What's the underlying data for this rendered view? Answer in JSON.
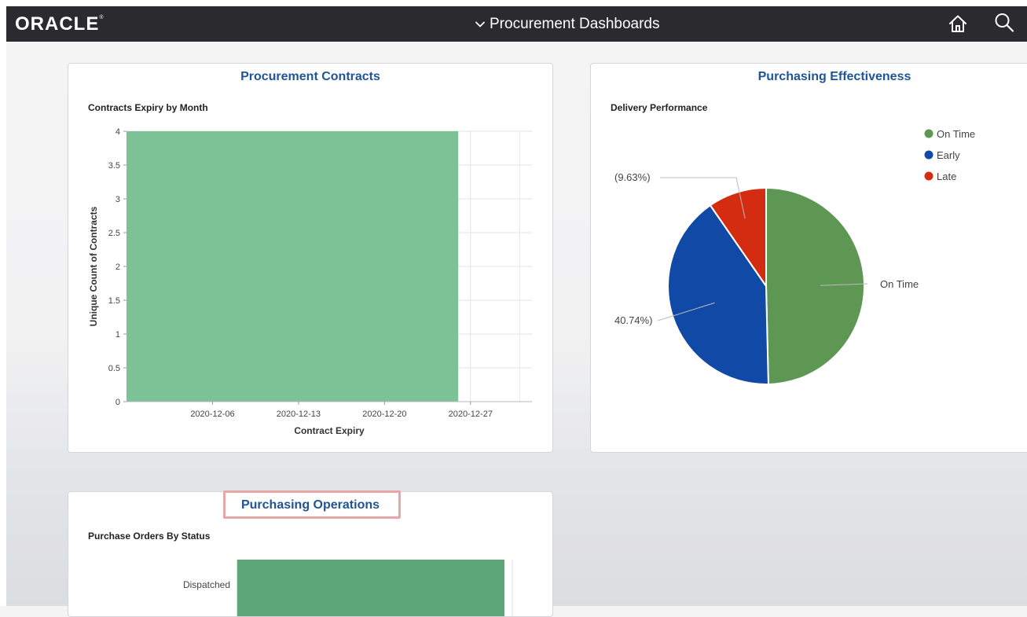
{
  "header": {
    "logo": "ORACLE",
    "title": "Procurement Dashboards",
    "icons": [
      "home-icon",
      "search-icon",
      "chevron-down-icon"
    ],
    "bar_color": "#2b2b2f"
  },
  "tiles": {
    "contracts": {
      "title": "Procurement Contracts",
      "chart_title": "Contracts Expiry by Month"
    },
    "effectiveness": {
      "title": "Purchasing Effectiveness",
      "chart_title": "Delivery Performance"
    },
    "operations": {
      "title": "Purchasing Operations",
      "chart_title": "Purchase Orders By Status"
    }
  },
  "chart_data": [
    {
      "type": "bar",
      "title": "Contracts Expiry by Month",
      "xlabel": "Contract Expiry",
      "ylabel": "Unique Count of Contracts",
      "x_ticks": [
        "2020-12-06",
        "2020-12-13",
        "2020-12-20",
        "2020-12-27"
      ],
      "y_ticks": [
        "0",
        "0.5",
        "1",
        "1.5",
        "2",
        "2.5",
        "3",
        "3.5",
        "4"
      ],
      "ylim": [
        0,
        4
      ],
      "bars": [
        {
          "x_start": "2020-11-29",
          "x_end": "2020-12-26",
          "value": 4
        }
      ],
      "grid": true,
      "color": "#7bc397"
    },
    {
      "type": "pie",
      "title": "Delivery Performance",
      "legend_position": "top-right",
      "series": [
        {
          "name": "On Time",
          "value": 49.63,
          "color": "#5e9653",
          "label": "On Time"
        },
        {
          "name": "Early",
          "value": 40.74,
          "color": "#1049a6",
          "label": "40.74%)"
        },
        {
          "name": "Late",
          "value": 9.63,
          "color": "#d42c11",
          "label": "(9.63%)"
        }
      ]
    },
    {
      "type": "bar",
      "title": "Purchase Orders By Status",
      "orientation": "horizontal",
      "categories": [
        "Dispatched"
      ],
      "color": "#5da678",
      "grid": true
    }
  ]
}
